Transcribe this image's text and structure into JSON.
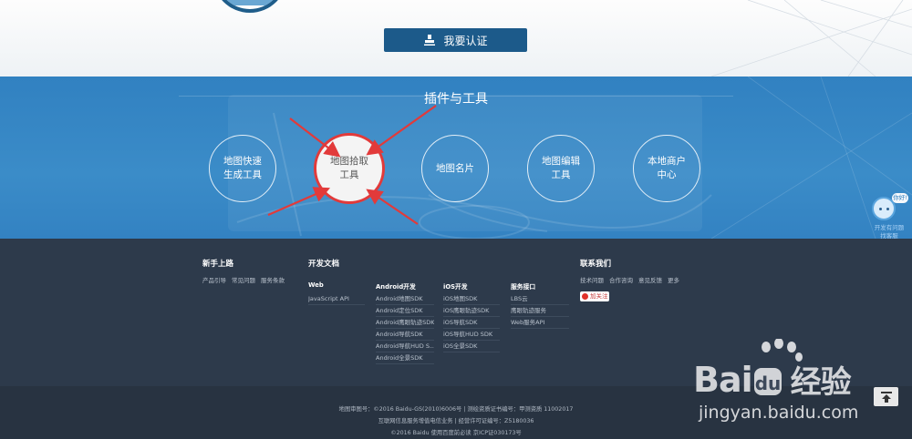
{
  "header": {
    "cert_button_label": "我要认证"
  },
  "tools": {
    "title": "插件与工具",
    "items": [
      {
        "label": "地图快速\n生成工具",
        "active": false
      },
      {
        "label": "地图拾取\n工具",
        "active": true
      },
      {
        "label": "地图名片",
        "active": false
      },
      {
        "label": "地图编辑\n工具",
        "active": false
      },
      {
        "label": "本地商户\n中心",
        "active": false
      }
    ],
    "annotation_color": "#e23a3a"
  },
  "chat": {
    "bubble": "你好!",
    "text": "开发有问题\n找客服"
  },
  "footer": {
    "newbie": {
      "title": "新手上路",
      "links": [
        "产品引导",
        "常见问题",
        "服务条款"
      ]
    },
    "docs": {
      "title": "开发文档",
      "web": {
        "title": "Web",
        "items": [
          "JavaScript API"
        ]
      },
      "android": {
        "title": "Android开发",
        "items": [
          "Android地图SDK",
          "Android定位SDK",
          "Android鹰眼轨迹SDK",
          "Android导航SDK",
          "Android导航HUD S...",
          "Android全景SDK"
        ]
      },
      "ios": {
        "title": "iOS开发",
        "items": [
          "iOS地图SDK",
          "iOS鹰眼轨迹SDK",
          "iOS导航SDK",
          "iOS导航HUD SDK",
          "iOS全景SDK"
        ]
      },
      "service": {
        "title": "服务接口",
        "items": [
          "LBS云",
          "鹰眼轨迹服务",
          "Web服务API"
        ]
      }
    },
    "contact": {
      "title": "联系我们",
      "links": [
        "技术问题",
        "合作咨询",
        "意见反馈",
        "更多"
      ],
      "weibo_label": "加关注"
    }
  },
  "bottom": {
    "line1": "地图审图号：©2016 Baidu-GS(2010)6006号    |    测绘资质证书编号：甲测资质 11002017",
    "line2": "互联网信息服务增值电信业务  |  经营许可证编号：Z5180036",
    "line3": "©2016 Baidu 使用百度前必读 京ICP证030173号"
  },
  "watermark": {
    "text_latin": "Bai",
    "text_cn": "经验",
    "url": "jingyan.baidu.com"
  },
  "colors": {
    "header_button": "#1c5a8a",
    "tools_bg": "#3181c1",
    "footer_bg": "#2d3a4b",
    "bottom_bg": "#283341"
  }
}
